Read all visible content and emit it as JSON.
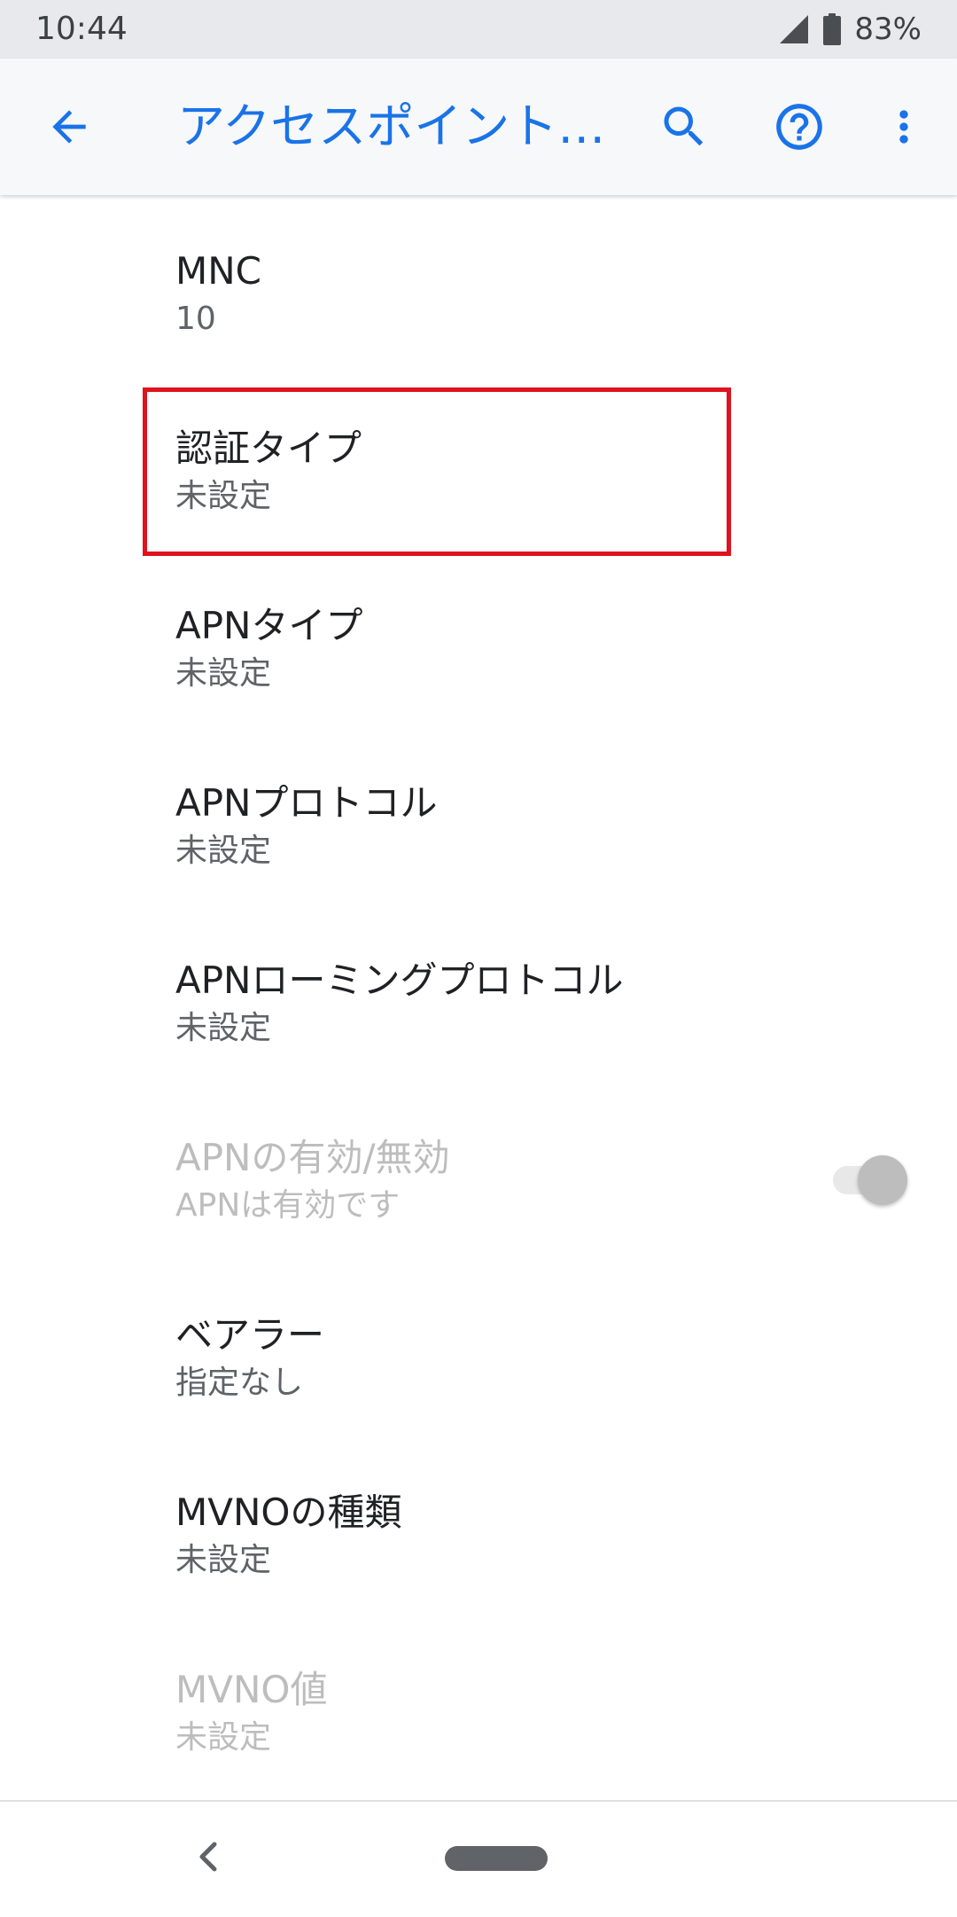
{
  "status_bar": {
    "time": "10:44",
    "battery": "83%"
  },
  "app_bar": {
    "title": "アクセスポイント…",
    "back_icon": "arrow-left-icon",
    "search_icon": "search-icon",
    "help_icon": "help-circle-icon",
    "more_icon": "more-vert-icon"
  },
  "preferences": [
    {
      "title": "MNC",
      "summary": "10"
    },
    {
      "title": "認証タイプ",
      "summary": "未設定"
    },
    {
      "title": "APNタイプ",
      "summary": "未設定"
    },
    {
      "title": "APNプロトコル",
      "summary": "未設定"
    },
    {
      "title": "APNローミングプロトコル",
      "summary": "未設定"
    },
    {
      "title": "APNの有効/無効",
      "summary": "APNは有効です"
    },
    {
      "title": "ベアラー",
      "summary": "指定なし"
    },
    {
      "title": "MVNOの種類",
      "summary": "未設定"
    },
    {
      "title": "MVNO値",
      "summary": "未設定"
    }
  ],
  "colors": {
    "accent": "#1a73e8",
    "highlight": "#e0121e",
    "disabled_text": "#bdbdbd"
  }
}
